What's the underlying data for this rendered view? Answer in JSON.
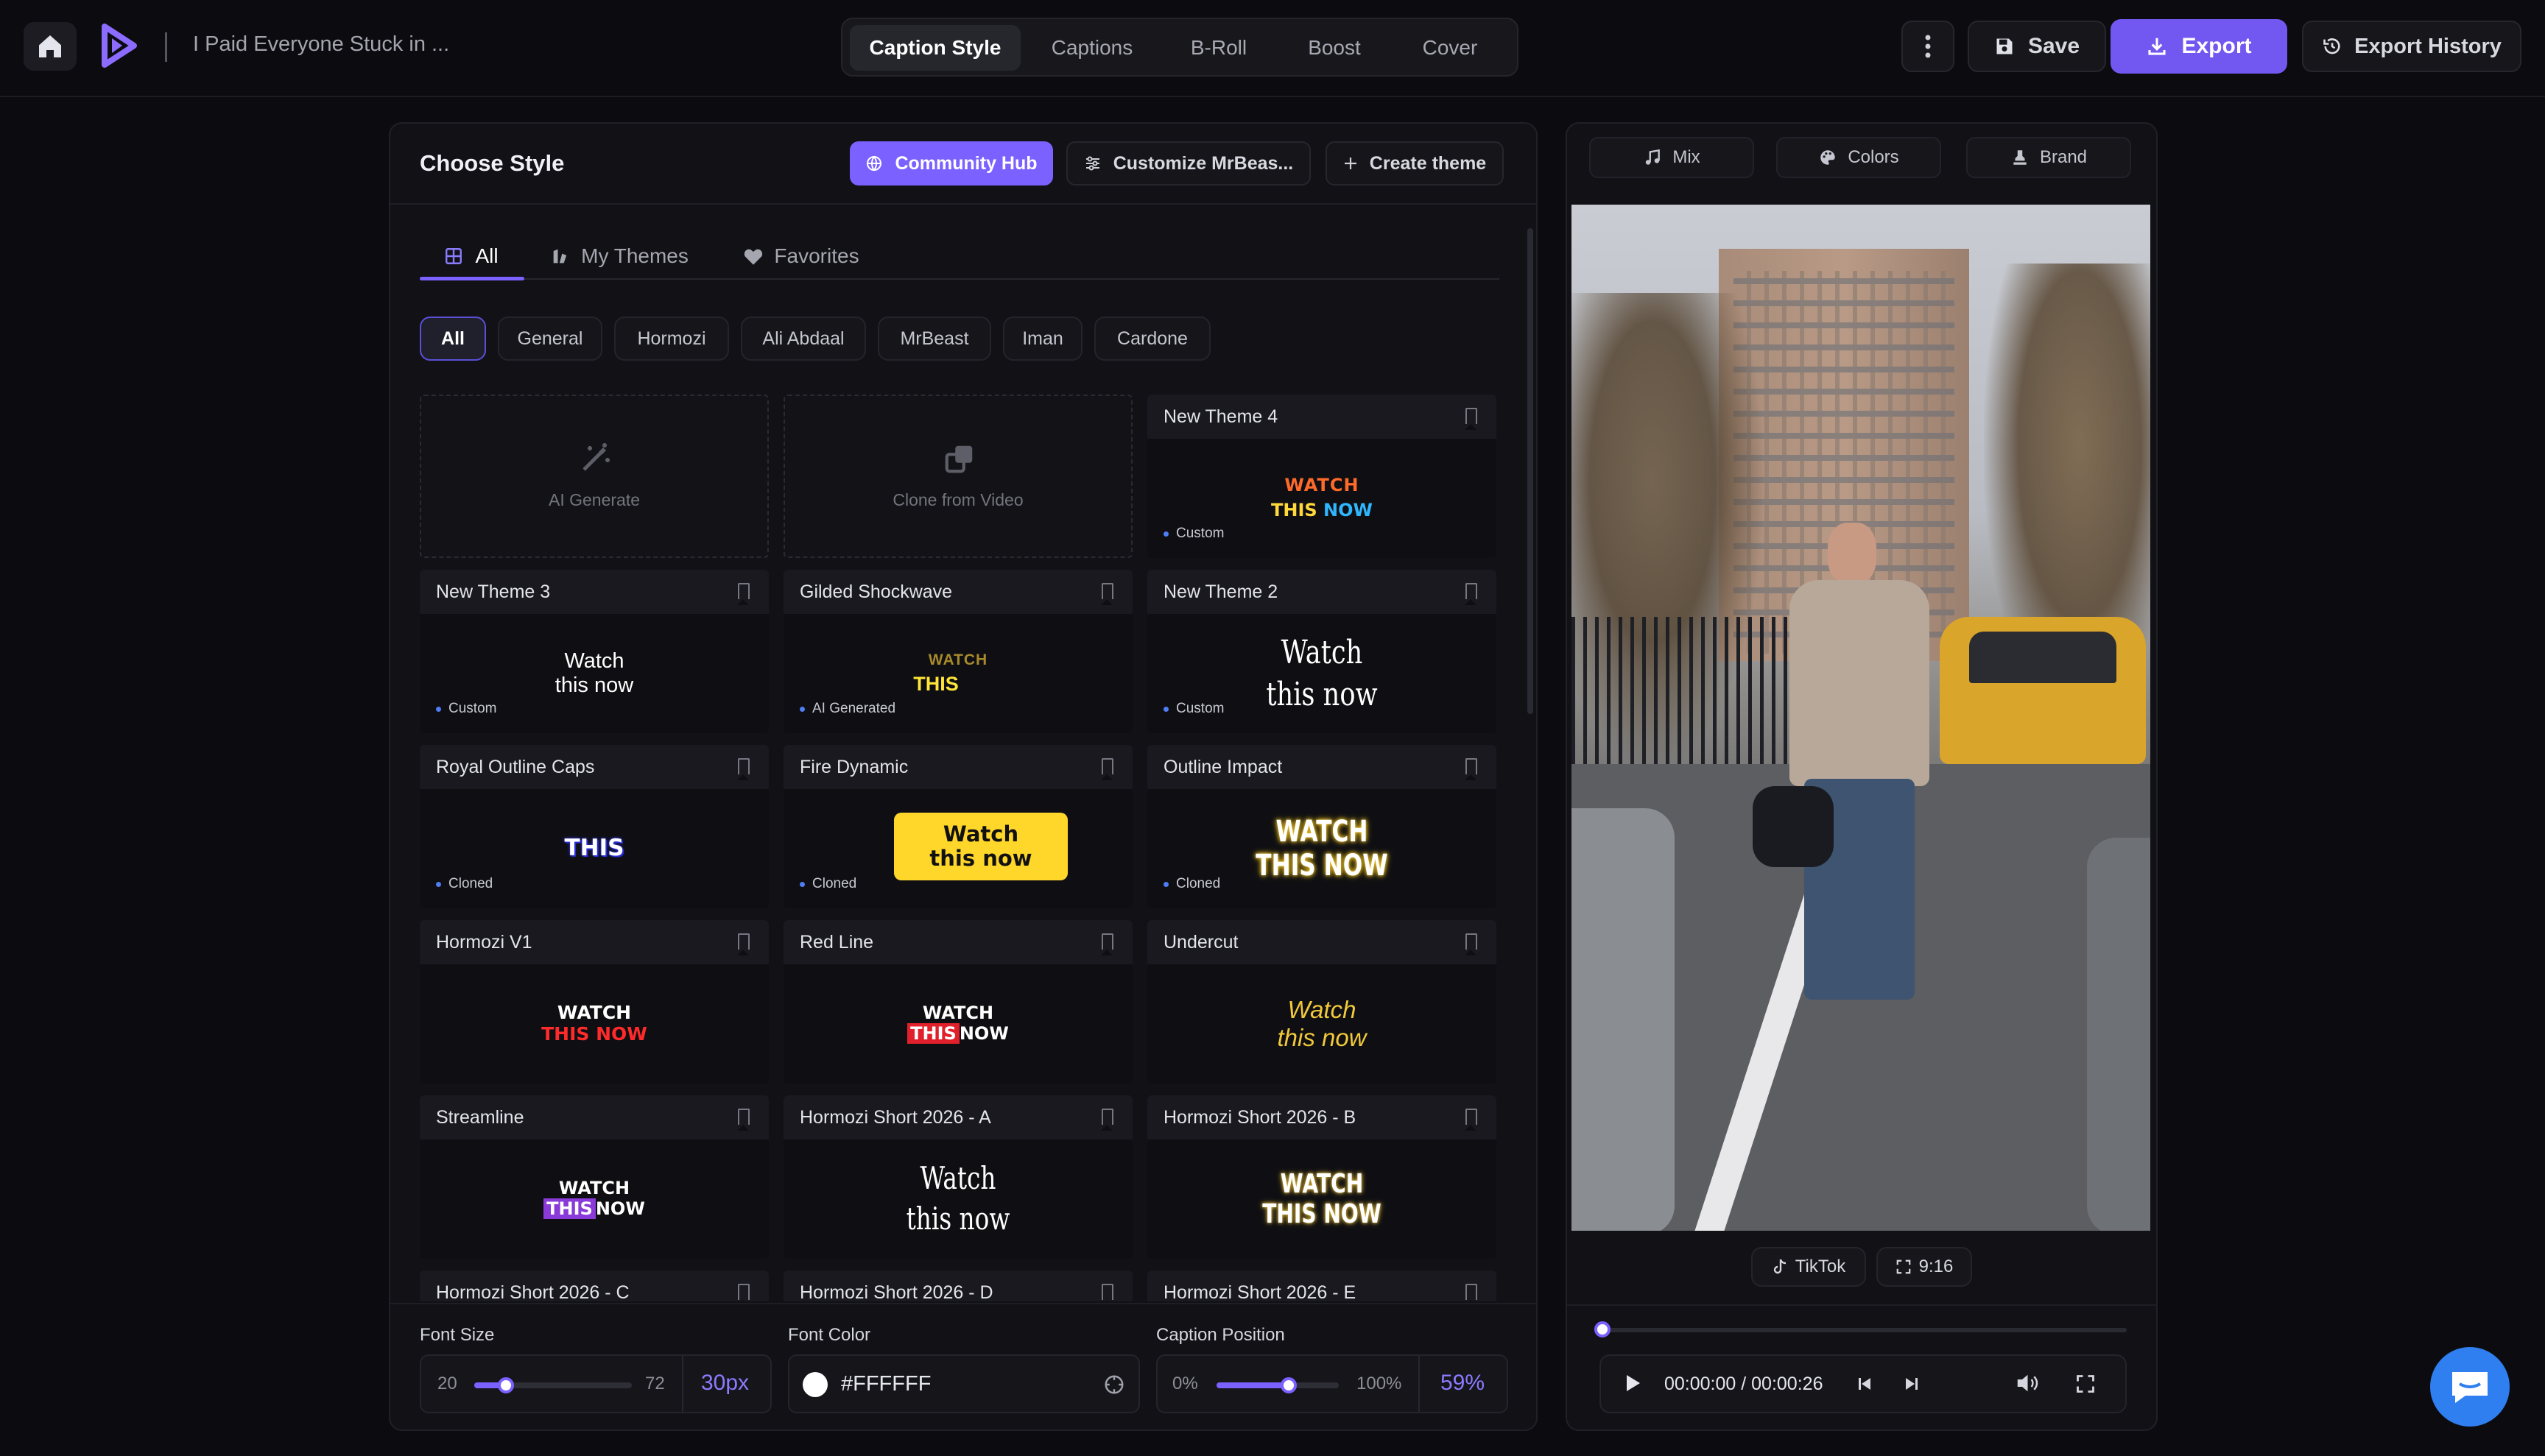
{
  "header": {
    "project_title": "I Paid Everyone Stuck in ...",
    "tabs": [
      {
        "label": "Caption Style"
      },
      {
        "label": "Captions"
      },
      {
        "label": "B-Roll"
      },
      {
        "label": "Boost"
      },
      {
        "label": "Cover"
      }
    ],
    "save_label": "Save",
    "export_label": "Export",
    "export_history_label": "Export History"
  },
  "style_panel": {
    "title": "Choose Style",
    "community_hub_label": "Community Hub",
    "customize_label": "Customize MrBeas...",
    "create_theme_label": "Create theme",
    "view_tabs": [
      {
        "label": "All"
      },
      {
        "label": "My Themes"
      },
      {
        "label": "Favorites"
      }
    ],
    "filters": [
      "All",
      "General",
      "Hormozi",
      "Ali Abdaal",
      "MrBeast",
      "Iman",
      "Cardone"
    ],
    "ai_generate_label": "AI Generate",
    "clone_label": "Clone from Video",
    "themes": [
      {
        "name": "New Theme 4",
        "tag": "Custom",
        "line1": "WATCH",
        "line2a": "THIS ",
        "line2b": "NOW"
      },
      {
        "name": "New Theme 3",
        "tag": "Custom",
        "line1": "Watch",
        "line2": "this now"
      },
      {
        "name": "Gilded Shockwave",
        "tag": "AI Generated",
        "line1": "WATCH",
        "line2": "THIS"
      },
      {
        "name": "New Theme 2",
        "tag": "Custom",
        "line1": "Watch",
        "line2": "this now"
      },
      {
        "name": "Royal Outline Caps",
        "tag": "Cloned",
        "line1": "THIS"
      },
      {
        "name": "Fire Dynamic",
        "tag": "Cloned",
        "line1": "Watch",
        "line2": "this now"
      },
      {
        "name": "Outline Impact",
        "tag": "Cloned",
        "line1": "WATCH",
        "line2": "THIS NOW"
      },
      {
        "name": "Hormozi V1",
        "line1": "WATCH",
        "line2": "THIS NOW"
      },
      {
        "name": "Red Line",
        "line1": "WATCH",
        "line2a": "THIS",
        "line2b": "NOW"
      },
      {
        "name": "Undercut",
        "line1": "Watch",
        "line2": "this now"
      },
      {
        "name": "Streamline",
        "line1": "WATCH",
        "line2a": "THIS",
        "line2b": "NOW"
      },
      {
        "name": "Hormozi Short 2026 - A",
        "line1": "Watch",
        "line2": "this now"
      },
      {
        "name": "Hormozi Short 2026 - B",
        "line1": "WATCH",
        "line2": "THIS NOW"
      },
      {
        "name": "Hormozi Short 2026 - C"
      },
      {
        "name": "Hormozi Short 2026 - D"
      },
      {
        "name": "Hormozi Short 2026 - E"
      }
    ],
    "font_size": {
      "label": "Font Size",
      "min": "20",
      "max": "72",
      "value": "30px",
      "fraction": 0.2
    },
    "font_color": {
      "label": "Font Color",
      "value": "#FFFFFF"
    },
    "caption_position": {
      "label": "Caption Position",
      "min": "0%",
      "max": "100%",
      "value": "59%",
      "fraction": 0.59
    }
  },
  "preview_panel": {
    "mix_label": "Mix",
    "colors_label": "Colors",
    "brand_label": "Brand",
    "platform_label": "TikTok",
    "ratio_label": "9:16",
    "time": "00:00:00 / 00:00:26",
    "progress_fraction": 0.0
  },
  "colors": {
    "accent": "#7b61ff",
    "export": "#7257f0",
    "chat": "#2f7ff0"
  }
}
